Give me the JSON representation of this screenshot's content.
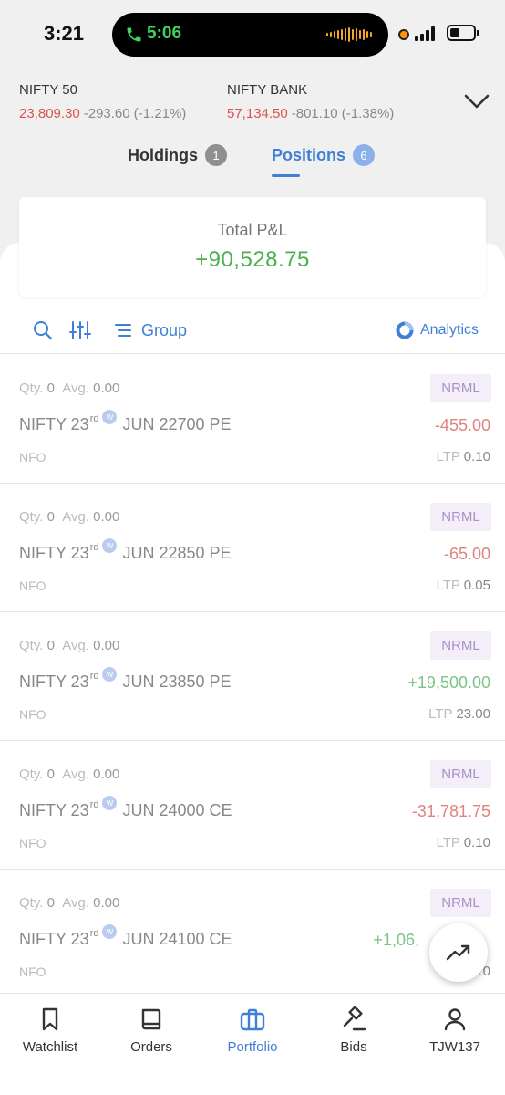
{
  "status_bar": {
    "time": "3:21",
    "call_time": "5:06"
  },
  "indices": [
    {
      "name": "NIFTY 50",
      "value": "23,809.30",
      "change": "-293.60 (-1.21%)"
    },
    {
      "name": "NIFTY BANK",
      "value": "57,134.50",
      "change": "-801.10 (-1.38%)"
    }
  ],
  "tabs": [
    {
      "label": "Holdings",
      "count": "1"
    },
    {
      "label": "Positions",
      "count": "6"
    }
  ],
  "summary": {
    "label": "Total P&L",
    "value": "+90,528.75"
  },
  "toolbar": {
    "group_label": "Group",
    "analytics_label": "Analytics"
  },
  "positions": [
    {
      "qty_label": "Qty.",
      "qty": "0",
      "avg_label": "Avg.",
      "avg": "0.00",
      "product": "NRML",
      "symbol": "NIFTY 23",
      "ordinal": "rd",
      "weekly": "W",
      "contract": "JUN 22700 PE",
      "pnl": "-455.00",
      "exchange": "NFO",
      "ltp_label": "LTP",
      "ltp": "0.10"
    },
    {
      "qty_label": "Qty.",
      "qty": "0",
      "avg_label": "Avg.",
      "avg": "0.00",
      "product": "NRML",
      "symbol": "NIFTY 23",
      "ordinal": "rd",
      "weekly": "W",
      "contract": "JUN 22850 PE",
      "pnl": "-65.00",
      "exchange": "NFO",
      "ltp_label": "LTP",
      "ltp": "0.05"
    },
    {
      "qty_label": "Qty.",
      "qty": "0",
      "avg_label": "Avg.",
      "avg": "0.00",
      "product": "NRML",
      "symbol": "NIFTY 23",
      "ordinal": "rd",
      "weekly": "W",
      "contract": "JUN 23850 PE",
      "pnl": "+19,500.00",
      "exchange": "NFO",
      "ltp_label": "LTP",
      "ltp": "23.00"
    },
    {
      "qty_label": "Qty.",
      "qty": "0",
      "avg_label": "Avg.",
      "avg": "0.00",
      "product": "NRML",
      "symbol": "NIFTY 23",
      "ordinal": "rd",
      "weekly": "W",
      "contract": "JUN 24000 CE",
      "pnl": "-31,781.75",
      "exchange": "NFO",
      "ltp_label": "LTP",
      "ltp": "0.10"
    },
    {
      "qty_label": "Qty.",
      "qty": "0",
      "avg_label": "Avg.",
      "avg": "0.00",
      "product": "NRML",
      "symbol": "NIFTY 23",
      "ordinal": "rd",
      "weekly": "W",
      "contract": "JUN 24100 CE",
      "pnl": "+1,06,",
      "exchange": "NFO",
      "ltp_label": "LTP",
      "ltp": "0.10"
    }
  ],
  "bottom_nav": [
    {
      "label": "Watchlist",
      "icon": "bookmark-icon"
    },
    {
      "label": "Orders",
      "icon": "book-icon"
    },
    {
      "label": "Portfolio",
      "icon": "briefcase-icon",
      "active": true
    },
    {
      "label": "Bids",
      "icon": "gavel-icon"
    },
    {
      "label": "TJW137",
      "icon": "user-icon"
    }
  ],
  "colors": {
    "accent": "#3f7fd8",
    "profit": "#4caf50",
    "loss": "#d9534f"
  }
}
